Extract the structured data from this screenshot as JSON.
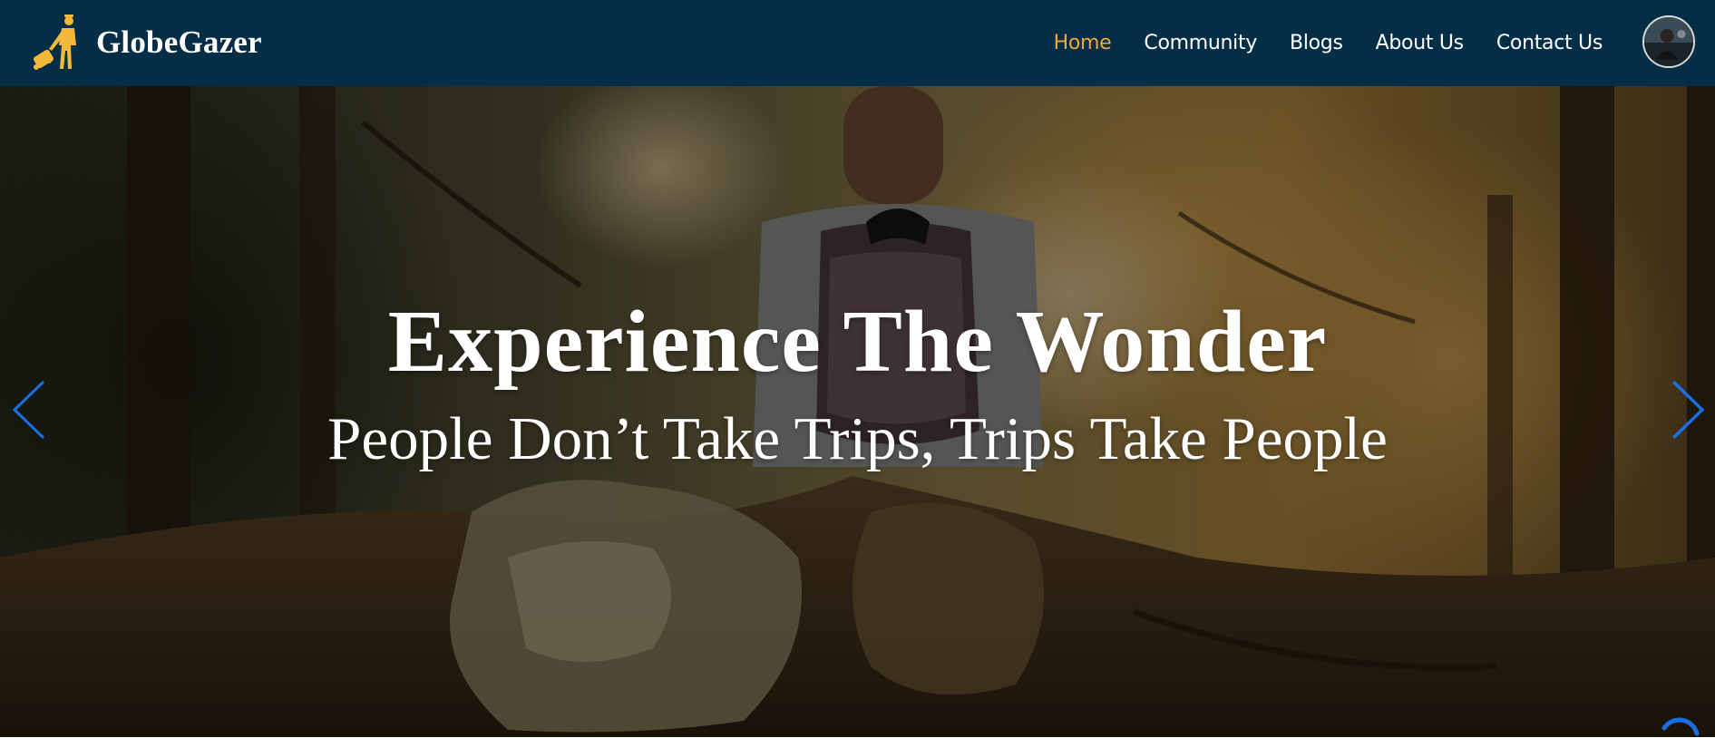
{
  "brand": {
    "name": "GlobeGazer",
    "logo_icon": "traveler-with-suitcase-icon",
    "logo_color": "#f2b93b"
  },
  "nav": {
    "items": [
      {
        "label": "Home",
        "active": true
      },
      {
        "label": "Community",
        "active": false
      },
      {
        "label": "Blogs",
        "active": false
      },
      {
        "label": "About Us",
        "active": false
      },
      {
        "label": "Contact Us",
        "active": false
      }
    ],
    "active_color": "#f2a93b",
    "background": "#042d46"
  },
  "user": {
    "avatar_icon": "user-avatar-icon"
  },
  "hero": {
    "title": "Experience The Wonder",
    "subtitle": "People Don’t Take Trips, Trips Take People",
    "prev_icon": "chevron-left-icon",
    "next_icon": "chevron-right-icon",
    "scroll_icon": "scroll-progress-icon",
    "control_color": "#1a6fe0"
  }
}
